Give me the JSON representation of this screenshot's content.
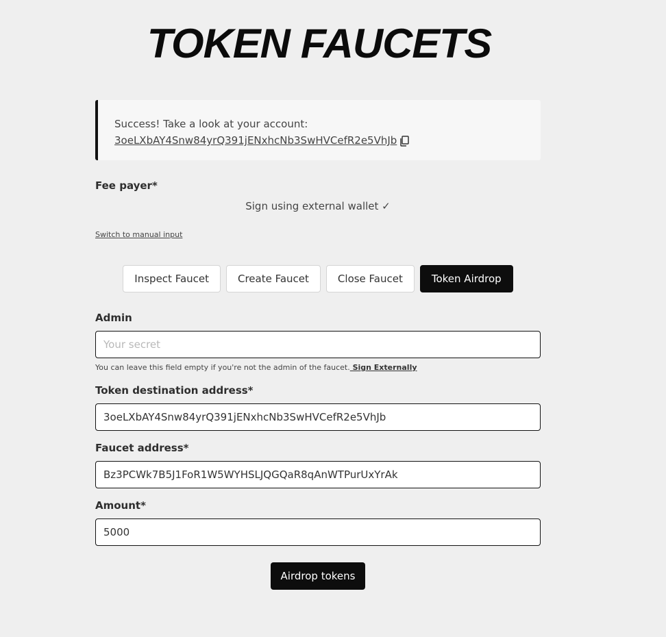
{
  "header": {
    "title": "TOKEN FAUCETS"
  },
  "success": {
    "message": "Success! Take a look at your account:",
    "account": "3oeLXbAY4Snw84yrQ391jENxhcNb3SwHVCefR2e5VhJb"
  },
  "fee_payer": {
    "label": "Fee payer*",
    "status": "Sign using external wallet ✓",
    "switch_link": "Switch to manual input"
  },
  "tabs": [
    {
      "label": "Inspect Faucet",
      "active": false
    },
    {
      "label": "Create Faucet",
      "active": false
    },
    {
      "label": "Close Faucet",
      "active": false
    },
    {
      "label": "Token Airdrop",
      "active": true
    }
  ],
  "form": {
    "admin": {
      "label": "Admin",
      "placeholder": "Your secret",
      "value": "",
      "hint": "You can leave this field empty if you're not the admin of the faucet.",
      "hint_link": " Sign Externally"
    },
    "destination": {
      "label": "Token destination address*",
      "value": "3oeLXbAY4Snw84yrQ391jENxhcNb3SwHVCefR2e5VhJb"
    },
    "faucet": {
      "label": "Faucet address*",
      "value": "Bz3PCWk7B5J1FoR1W5WYHSLJQGQaR8qAnWTPurUxYrAk"
    },
    "amount": {
      "label": "Amount*",
      "value": "5000"
    },
    "submit_label": "Airdrop tokens"
  }
}
